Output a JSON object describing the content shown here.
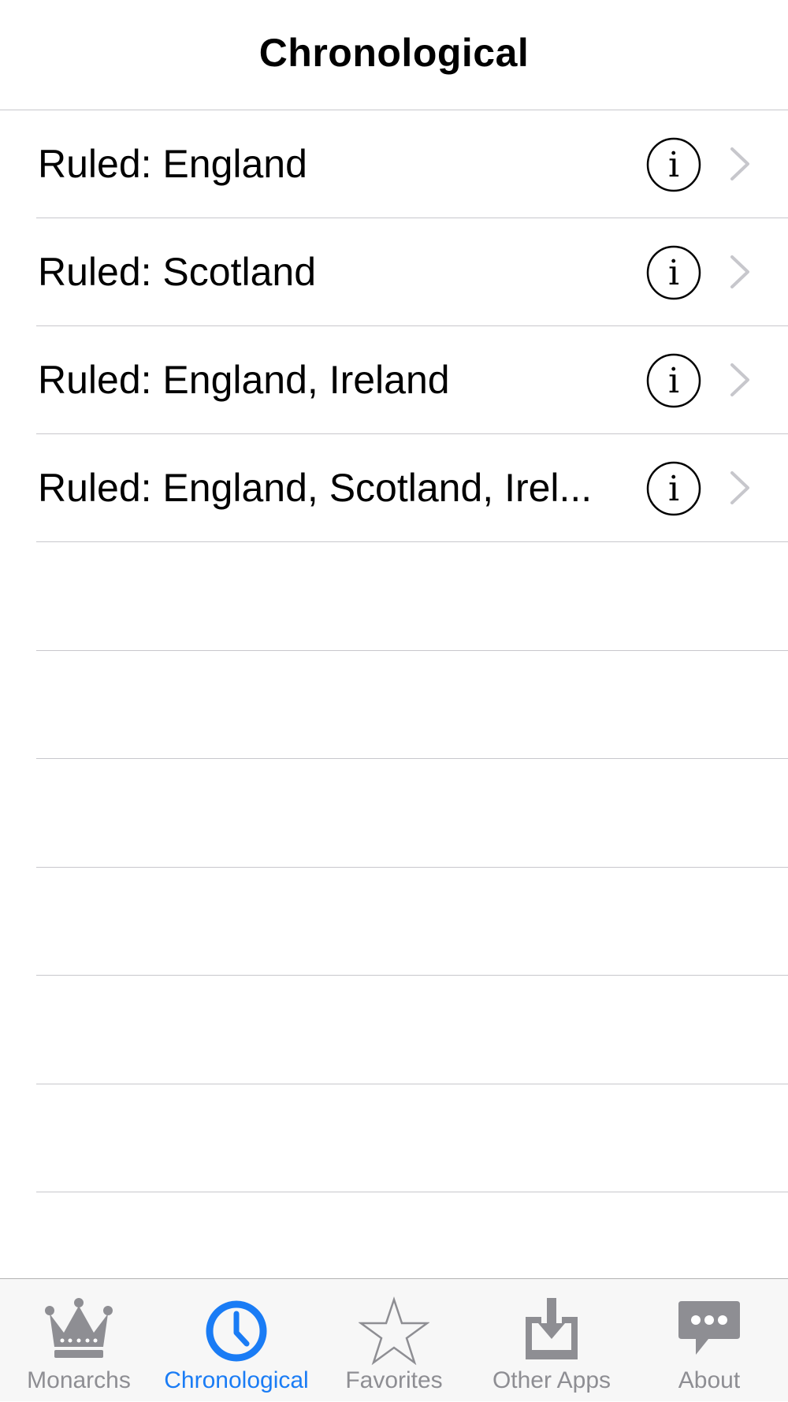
{
  "nav": {
    "title": "Chronological"
  },
  "list": {
    "rows": [
      {
        "label": "Ruled: England",
        "info_icon": "info-icon",
        "chevron_icon": "chevron-right-icon"
      },
      {
        "label": "Ruled: Scotland",
        "info_icon": "info-icon",
        "chevron_icon": "chevron-right-icon"
      },
      {
        "label": "Ruled: England, Ireland",
        "info_icon": "info-icon",
        "chevron_icon": "chevron-right-icon"
      },
      {
        "label": "Ruled: England, Scotland, Irel...",
        "info_icon": "info-icon",
        "chevron_icon": "chevron-right-icon"
      }
    ]
  },
  "tab_bar": {
    "tabs": [
      {
        "label": "Monarchs",
        "icon": "crown-icon",
        "active": false
      },
      {
        "label": "Chronological",
        "icon": "clock-icon",
        "active": true
      },
      {
        "label": "Favorites",
        "icon": "star-icon",
        "active": false
      },
      {
        "label": "Other Apps",
        "icon": "download-tray-icon",
        "active": false
      },
      {
        "label": "About",
        "icon": "speech-bubble-icon",
        "active": false
      }
    ]
  },
  "colors": {
    "accent": "#1a7cf5",
    "inactive": "#8e8e93",
    "separator": "#c8c7cc",
    "tab_bar_bg": "#f7f7f7"
  }
}
